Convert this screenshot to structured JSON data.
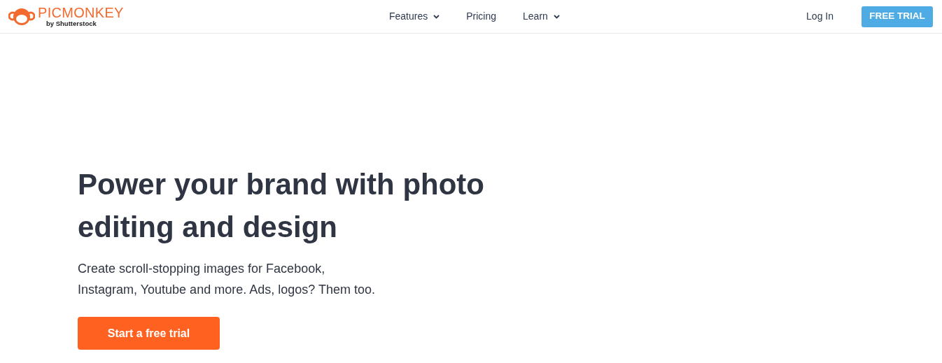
{
  "header": {
    "logo": {
      "wordmark": "PICMONKEY",
      "byline": "by Shutterstock"
    },
    "nav": [
      {
        "label": "Features",
        "dropdown": true
      },
      {
        "label": "Pricing",
        "dropdown": false
      },
      {
        "label": "Learn",
        "dropdown": true
      }
    ],
    "login": "Log In",
    "cta": "FREE TRIAL"
  },
  "hero": {
    "heading": "Power your brand with photo editing and design",
    "subtitle": "Create scroll-stopping images for Facebook, Instagram, Youtube and more. Ads, logos? Them too.",
    "button": "Start a free trial"
  }
}
